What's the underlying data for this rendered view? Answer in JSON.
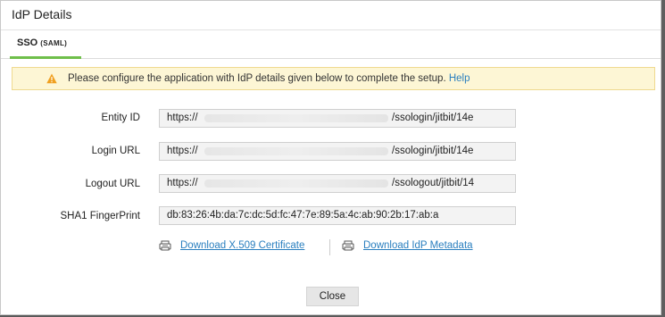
{
  "modal": {
    "title": "IdP Details"
  },
  "tabs": [
    {
      "label": "SSO",
      "sub": "(SAML)"
    }
  ],
  "notice": {
    "text": "Please configure the application with IdP details given below to complete the setup.",
    "help_link": "Help",
    "icon": "warning-icon"
  },
  "fields": [
    {
      "label": "Entity ID",
      "prefix": "https://",
      "suffix": "/ssologin/jitbit/14e"
    },
    {
      "label": "Login URL",
      "prefix": "https://",
      "suffix": "/ssologin/jitbit/14e"
    },
    {
      "label": "Logout URL",
      "prefix": "https://",
      "suffix": "/ssologout/jitbit/14"
    },
    {
      "label": "SHA1 FingerPrint",
      "value": "db:83:26:4b:da:7c:dc:5d:fc:47:7e:89:5a:4c:ab:90:2b:17:ab:a"
    }
  ],
  "downloads": [
    {
      "label": "Download X.509 Certificate",
      "icon": "certificate-download-icon"
    },
    {
      "label": "Download IdP Metadata",
      "icon": "metadata-download-icon"
    }
  ],
  "footer": {
    "close_label": "Close"
  },
  "colors": {
    "accent_green": "#6fbf4a",
    "link_blue": "#2a7fbf",
    "notice_bg": "#fdf6d5",
    "warning_orange": "#f0a020"
  }
}
